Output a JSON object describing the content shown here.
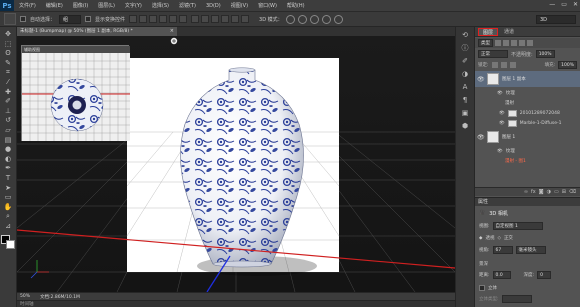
{
  "app": {
    "logo": "Ps"
  },
  "menu": [
    "文件(F)",
    "编辑(E)",
    "图像(I)",
    "图层(L)",
    "文字(Y)",
    "选择(S)",
    "滤镜(T)",
    "3D(D)",
    "视图(V)",
    "窗口(W)",
    "帮助(H)"
  ],
  "window_controls": {
    "minimize": "—",
    "restore": "▭",
    "close": "✕"
  },
  "options": {
    "auto_select_label": "自动选择：",
    "auto_select_value": "组",
    "show_transform_label": "显示变换控件",
    "mode3d_label": "3D 模式：",
    "workspace": "3D"
  },
  "doc": {
    "tab_title": "未标题-1 (Bumpmap) @ 50% (图层 1 副本, RGB/8) *",
    "close": "×",
    "secondary_title": "辅助视图",
    "zoom": "50%",
    "doc_info": "文档:2.86M/10.1M",
    "timeline": "时间轴"
  },
  "panel": {
    "tabs": [
      "图层",
      "通道"
    ],
    "kind_label": "类型",
    "blend_mode": "正常",
    "opacity_label": "不透明度:",
    "opacity": "100%",
    "lock_label": "锁定:",
    "fill_label": "填充:",
    "fill": "100%",
    "layers": [
      {
        "name": "图层 1 副本",
        "sub": [
          "纹理",
          "漫射",
          "20101289072048",
          "Marble-1-Diffuse-1"
        ]
      },
      {
        "name": "图层 1",
        "sub": [
          "纹理",
          "漫射 - 图1"
        ]
      }
    ],
    "footer_icons": [
      "link-icon",
      "fx-icon",
      "mask-icon",
      "adjust-icon",
      "folder-icon",
      "new-layer-icon",
      "trash-icon"
    ]
  },
  "properties": {
    "header": "属性",
    "title": "3D 相机",
    "view_label": "视图:",
    "view_value": "自定视图 1",
    "perspective": "透视",
    "orthographic": "正交",
    "fov_label": "视角:",
    "fov_value": "67",
    "lens_label": "毫米镜头",
    "dof_label": "景深",
    "distance_label": "距离:",
    "distance_value": "0.0",
    "depth_label": "深度:",
    "depth_value": "0",
    "stereo_label": "立体",
    "stereo_type_label": "立体类型:"
  }
}
